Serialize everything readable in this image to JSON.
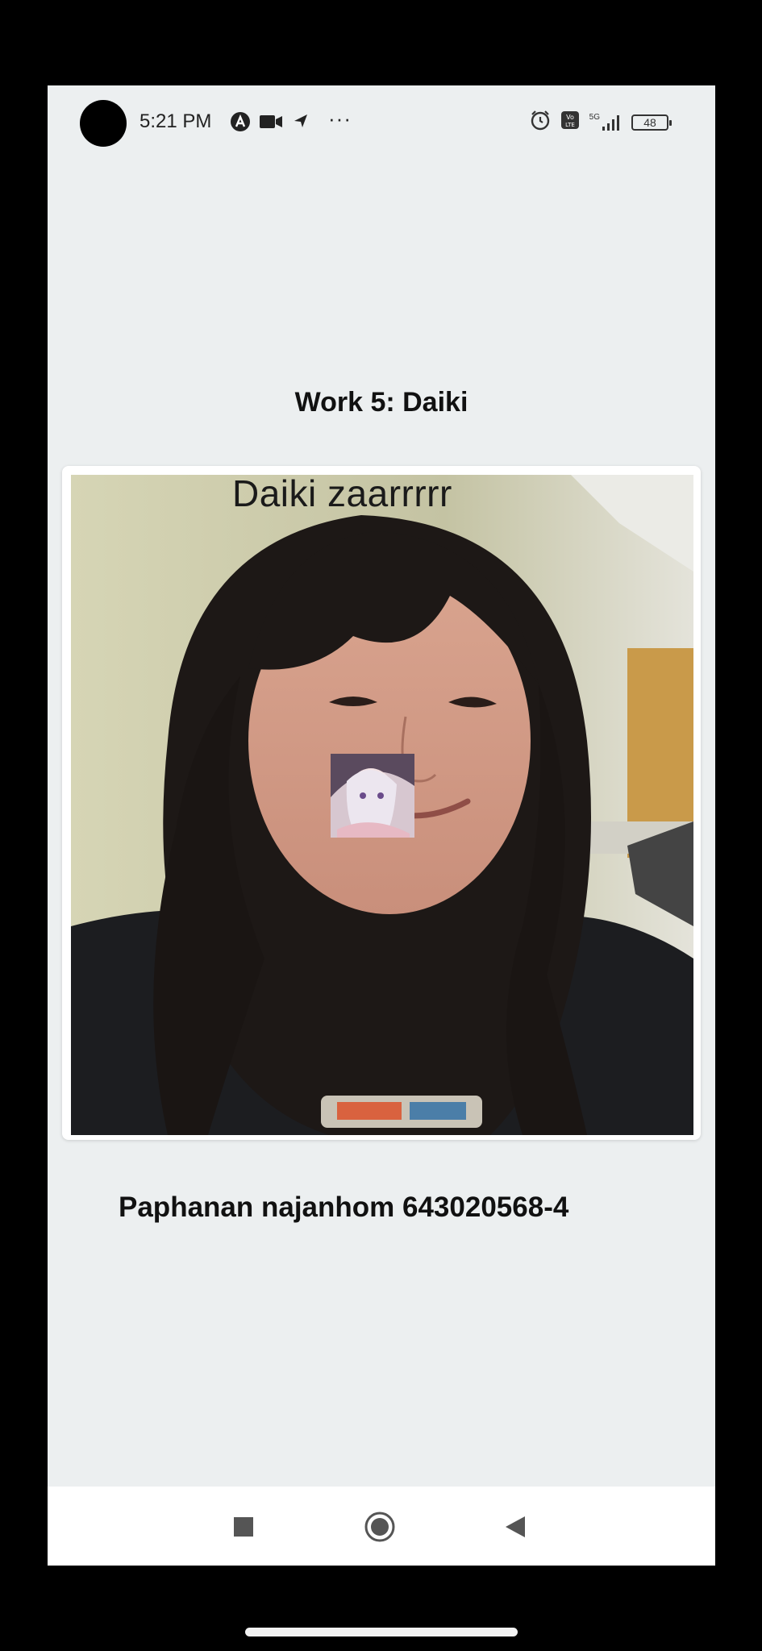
{
  "status_bar": {
    "time": "5:21 PM",
    "overflow": "···",
    "battery": "48",
    "network": "5G",
    "icons": [
      "camera-hole",
      "app-a-icon",
      "video-icon",
      "location-icon",
      "alarm-icon",
      "volte-icon",
      "signal-icon",
      "battery-icon"
    ]
  },
  "page": {
    "title": "Work 5: Daiki",
    "photo_caption": "Daiki zaarrrrr",
    "credit": "Paphanan najanhom 643020568-4"
  },
  "nav_bar": {
    "icons": [
      "recents-square-icon",
      "home-circle-icon",
      "back-triangle-icon"
    ]
  },
  "colors": {
    "screen_bg": "#eceff0",
    "card_bg": "#ffffff",
    "nav_bg": "#ffffff",
    "text": "#111111"
  }
}
